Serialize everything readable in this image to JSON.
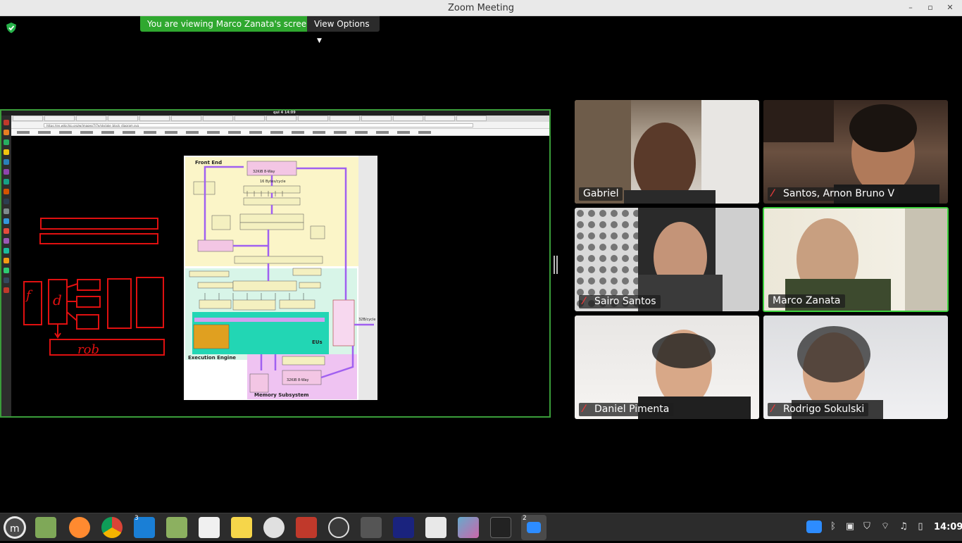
{
  "window": {
    "title": "Zoom Meeting",
    "controls": {
      "minimize": "–",
      "restore": "▫",
      "close": "✕"
    }
  },
  "share_banner": {
    "viewing_text": "You are viewing Marco Zanata's screen",
    "view_options_label": "View Options"
  },
  "shared_screen": {
    "clock": "qui 4 14:09",
    "url": "https://en.wikichip.org/w/images/7/7e/skylake_block_diagram.svg",
    "diagram_labels": {
      "front_end": "Front End",
      "execution_engine": "Execution Engine",
      "memory_subsystem": "Memory Subsystem",
      "eus": "EUs",
      "l1_icache": "32KiB 8-Way",
      "l1_dcache": "32KiB 8-Way",
      "bw": "16 Bytes/cycle",
      "bw2": "32B/cycle"
    },
    "handwriting": {
      "letter_f": "f",
      "letter_d": "d",
      "word_rob": "rob"
    }
  },
  "participants": [
    {
      "name": "Gabriel",
      "muted": false,
      "active": false
    },
    {
      "name": "Santos, Arnon Bruno V",
      "muted": true,
      "active": false
    },
    {
      "name": "Sairo Santos",
      "muted": true,
      "active": false
    },
    {
      "name": "Marco Zanata",
      "muted": false,
      "active": true
    },
    {
      "name": "Daniel Pimenta",
      "muted": true,
      "active": false
    },
    {
      "name": "Rodrigo Sokulski",
      "muted": true,
      "active": false
    }
  ],
  "taskbar": {
    "badges": {
      "vscode": "3",
      "zoom": "2"
    },
    "clock": "14:09"
  },
  "colors": {
    "banner_green": "#2fa82f",
    "active_speaker": "#3dd23d",
    "annotation_red": "#e01010"
  }
}
